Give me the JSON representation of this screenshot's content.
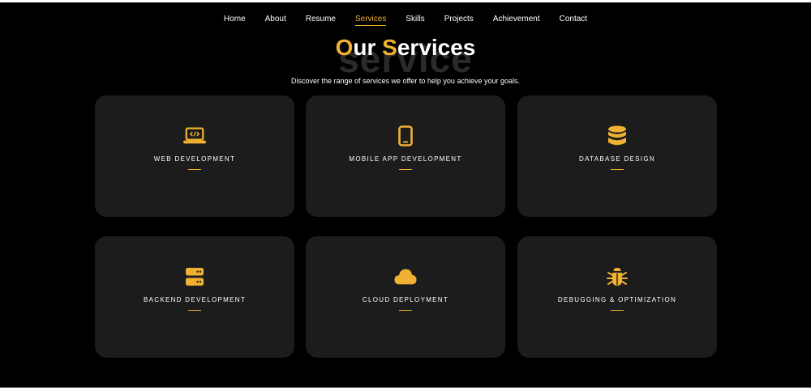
{
  "nav": {
    "items": [
      {
        "label": "Home"
      },
      {
        "label": "About"
      },
      {
        "label": "Resume"
      },
      {
        "label": "Services",
        "active": true
      },
      {
        "label": "Skills"
      },
      {
        "label": "Projects"
      },
      {
        "label": "Achievement"
      },
      {
        "label": "Contact"
      }
    ]
  },
  "hero": {
    "title_accent_1": "O",
    "title_rest_1": "ur ",
    "title_accent_2": "S",
    "title_rest_2": "ervices",
    "background_word": "service",
    "subtitle": "Discover the range of services we offer to help you achieve your goals."
  },
  "services": [
    {
      "label": "WEB DEVELOPMENT",
      "icon": "laptop-code-icon"
    },
    {
      "label": "MOBILE APP DEVELOPMENT",
      "icon": "mobile-icon"
    },
    {
      "label": "DATABASE DESIGN",
      "icon": "database-icon"
    },
    {
      "label": "BACKEND DEVELOPMENT",
      "icon": "server-icon"
    },
    {
      "label": "CLOUD DEPLOYMENT",
      "icon": "cloud-icon"
    },
    {
      "label": "DEBUGGING & OPTIMIZATION",
      "icon": "bug-icon"
    }
  ],
  "colors": {
    "accent": "#f0b132",
    "background": "#000000",
    "card": "#1c1c1c",
    "text": "#ffffff"
  }
}
